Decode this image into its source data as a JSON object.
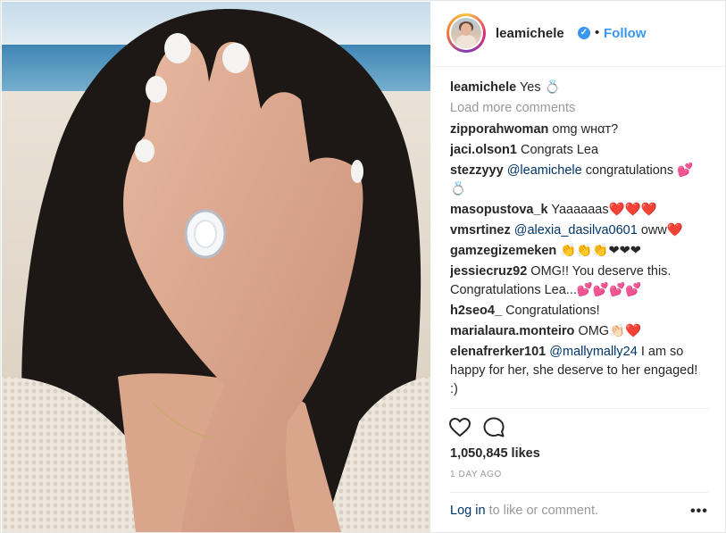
{
  "post": {
    "username": "leamichele",
    "follow_dot": "•",
    "follow_label": "Follow",
    "verified_mark": "✓",
    "caption_user": "leamichele",
    "caption_text": "Yes 💍",
    "load_more": "Load more comments",
    "comments": [
      {
        "user": "zipporahwoman",
        "mention": "",
        "text": "omg wнαт?"
      },
      {
        "user": "jaci.olson1",
        "mention": "",
        "text": "Congrats Lea"
      },
      {
        "user": "stezzyyy",
        "mention": "@leamichele",
        "text": "congratulations 💕 💍"
      },
      {
        "user": "masopustova_k",
        "mention": "",
        "text": "Yaaaaaas❤️❤️❤️"
      },
      {
        "user": "vmsrtinez",
        "mention": "@alexia_dasilva0601",
        "text": "oww❤️"
      },
      {
        "user": "gamzegizemeken",
        "mention": "",
        "text": "👏👏👏❤❤❤"
      },
      {
        "user": "jessiecruz92",
        "mention": "",
        "text": "OMG!! You deserve this. Congratulations Lea...💕💕💕💕"
      },
      {
        "user": "h2seo4_",
        "mention": "",
        "text": "Congratulations!"
      },
      {
        "user": "marialaura.monteiro",
        "mention": "",
        "text": "OMG👏🏻❤️"
      },
      {
        "user": "elenafrerker101",
        "mention": "@mallymally24",
        "text": "I am so happy for her, she deserve to her engaged! :)"
      }
    ],
    "likes": "1,050,845 likes",
    "time_ago": "1 DAY AGO",
    "login_link": "Log in",
    "login_rest": " to like or comment.",
    "more_label": "•••"
  },
  "icons": {
    "like": "heart-outline-icon",
    "comment": "speech-bubble-icon",
    "verified": "verified-badge-icon"
  },
  "colors": {
    "link_blue": "#3897f0",
    "mention_navy": "#003569",
    "muted": "#999999",
    "text": "#262626"
  }
}
